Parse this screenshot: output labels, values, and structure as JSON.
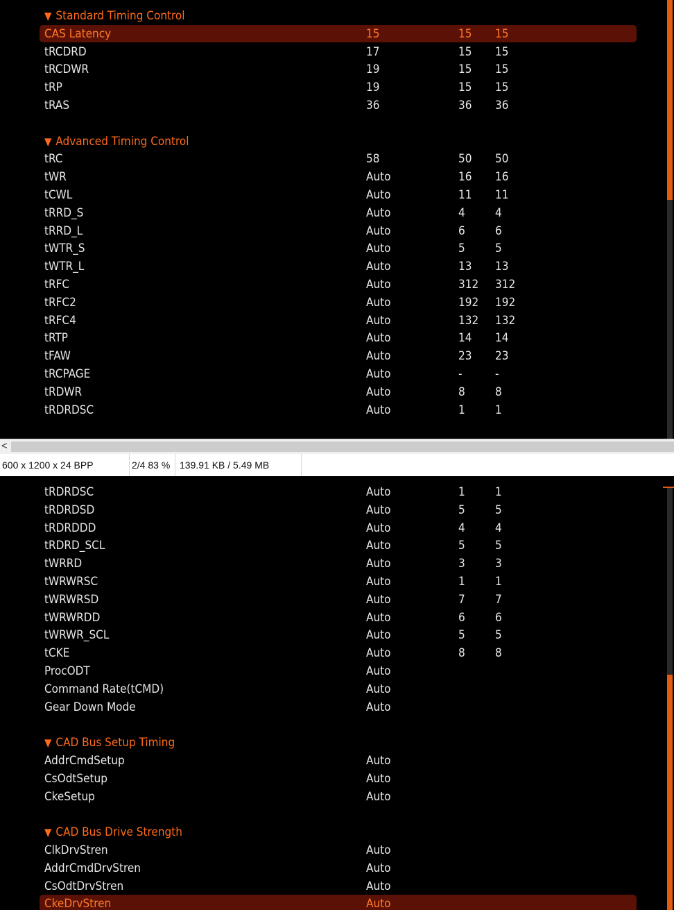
{
  "top_panel": {
    "sections": [
      {
        "title": "Standard Timing Control",
        "rows": [
          {
            "name": "CAS Latency",
            "v1": "15",
            "v2": "15",
            "v3": "15",
            "highlighted": true
          },
          {
            "name": "tRCDRD",
            "v1": "17",
            "v2": "15",
            "v3": "15"
          },
          {
            "name": "tRCDWR",
            "v1": "19",
            "v2": "15",
            "v3": "15"
          },
          {
            "name": "tRP",
            "v1": "19",
            "v2": "15",
            "v3": "15"
          },
          {
            "name": "tRAS",
            "v1": "36",
            "v2": "36",
            "v3": "36"
          }
        ]
      },
      {
        "title": "Advanced Timing Control",
        "rows": [
          {
            "name": "tRC",
            "v1": "58",
            "v2": "50",
            "v3": "50"
          },
          {
            "name": "tWR",
            "v1": "Auto",
            "v2": "16",
            "v3": "16"
          },
          {
            "name": "tCWL",
            "v1": "Auto",
            "v2": "11",
            "v3": "11"
          },
          {
            "name": "tRRD_S",
            "v1": "Auto",
            "v2": "4",
            "v3": "4"
          },
          {
            "name": "tRRD_L",
            "v1": "Auto",
            "v2": "6",
            "v3": "6"
          },
          {
            "name": "tWTR_S",
            "v1": "Auto",
            "v2": "5",
            "v3": "5"
          },
          {
            "name": "tWTR_L",
            "v1": "Auto",
            "v2": "13",
            "v3": "13"
          },
          {
            "name": "tRFC",
            "v1": "Auto",
            "v2": "312",
            "v3": "312"
          },
          {
            "name": "tRFC2",
            "v1": "Auto",
            "v2": "192",
            "v3": "192"
          },
          {
            "name": "tRFC4",
            "v1": "Auto",
            "v2": "132",
            "v3": "132"
          },
          {
            "name": "tRTP",
            "v1": "Auto",
            "v2": "14",
            "v3": "14"
          },
          {
            "name": "tFAW",
            "v1": "Auto",
            "v2": "23",
            "v3": "23"
          },
          {
            "name": "tRCPAGE",
            "v1": "Auto",
            "v2": "-",
            "v3": "-"
          },
          {
            "name": "tRDWR",
            "v1": "Auto",
            "v2": "8",
            "v3": "8"
          },
          {
            "name": "tRDRDSC",
            "v1": "Auto",
            "v2": "1",
            "v3": "1"
          }
        ]
      }
    ]
  },
  "statusbar": {
    "image_info": "600 x 1200 x 24 BPP",
    "page_zoom": "2/4 83 %",
    "file_size": "139.91 KB / 5.49 MB"
  },
  "bottom_panel": {
    "sections": [
      {
        "title": "",
        "rows": [
          {
            "name": "tRDRDSC",
            "v1": "Auto",
            "v2": "1",
            "v3": "1"
          },
          {
            "name": "tRDRDSD",
            "v1": "Auto",
            "v2": "5",
            "v3": "5"
          },
          {
            "name": "tRDRDDD",
            "v1": "Auto",
            "v2": "4",
            "v3": "4"
          },
          {
            "name": "tRDRD_SCL",
            "v1": "Auto",
            "v2": "5",
            "v3": "5"
          },
          {
            "name": "tWRRD",
            "v1": "Auto",
            "v2": "3",
            "v3": "3"
          },
          {
            "name": "tWRWRSC",
            "v1": "Auto",
            "v2": "1",
            "v3": "1"
          },
          {
            "name": "tWRWRSD",
            "v1": "Auto",
            "v2": "7",
            "v3": "7"
          },
          {
            "name": "tWRWRDD",
            "v1": "Auto",
            "v2": "6",
            "v3": "6"
          },
          {
            "name": "tWRWR_SCL",
            "v1": "Auto",
            "v2": "5",
            "v3": "5"
          },
          {
            "name": "tCKE",
            "v1": "Auto",
            "v2": "8",
            "v3": "8"
          },
          {
            "name": "ProcODT",
            "v1": "Auto",
            "v2": "",
            "v3": ""
          },
          {
            "name": "Command Rate(tCMD)",
            "v1": "Auto",
            "v2": "",
            "v3": ""
          },
          {
            "name": "Gear Down Mode",
            "v1": "Auto",
            "v2": "",
            "v3": ""
          }
        ]
      },
      {
        "title": "CAD Bus Setup Timing",
        "rows": [
          {
            "name": "AddrCmdSetup",
            "v1": "Auto",
            "v2": "",
            "v3": ""
          },
          {
            "name": "CsOdtSetup",
            "v1": "Auto",
            "v2": "",
            "v3": ""
          },
          {
            "name": "CkeSetup",
            "v1": "Auto",
            "v2": "",
            "v3": ""
          }
        ]
      },
      {
        "title": "CAD Bus Drive Strength",
        "rows": [
          {
            "name": "ClkDrvStren",
            "v1": "Auto",
            "v2": "",
            "v3": ""
          },
          {
            "name": "AddrCmdDrvStren",
            "v1": "Auto",
            "v2": "",
            "v3": ""
          },
          {
            "name": "CsOdtDrvStren",
            "v1": "Auto",
            "v2": "",
            "v3": ""
          },
          {
            "name": "CkeDrvStren",
            "v1": "Auto",
            "v2": "",
            "v3": "",
            "highlighted": true
          }
        ]
      }
    ]
  },
  "colors": {
    "section_title": "#ff6a1a",
    "highlight_bg": "#5c1106",
    "highlight_text": "#ff7a2a",
    "scroll_thumb": "#e15b14"
  },
  "icons": {
    "section_toggle": "triangle-down-icon",
    "scroll_left": "chevron-left-icon"
  }
}
